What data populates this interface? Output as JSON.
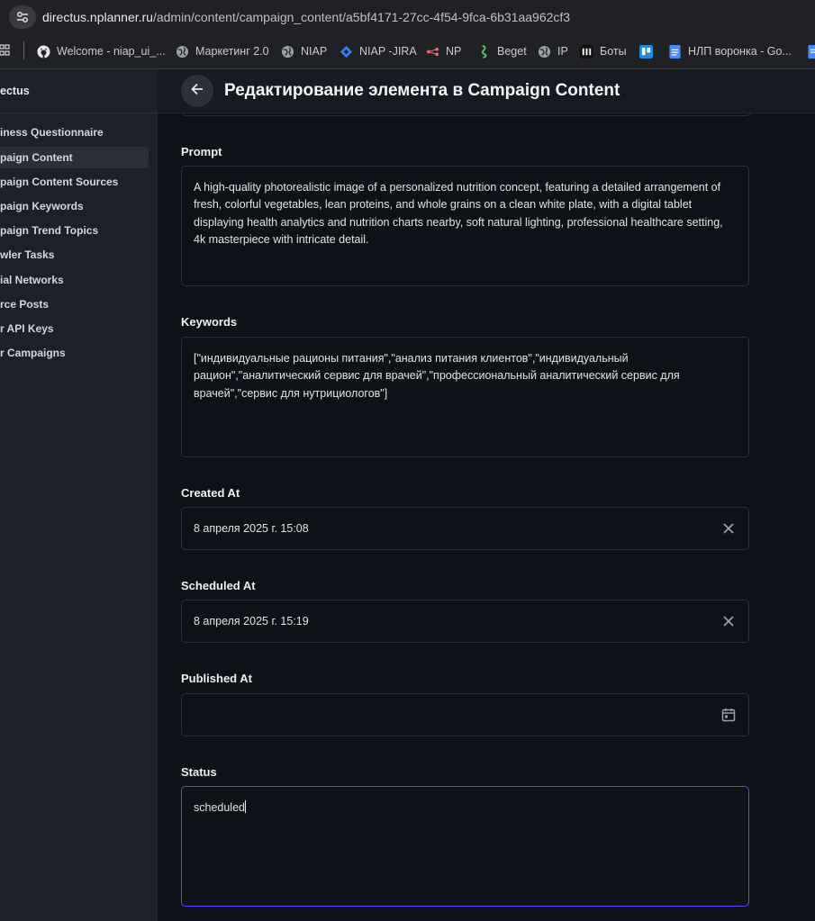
{
  "browser": {
    "url_host": "directus.nplanner.ru",
    "url_path": "/admin/content/campaign_content/a5bf4171-27cc-4f54-9fca-6b31aa962cf3",
    "bookmarks": [
      {
        "label": "Welcome - niap_ui_...",
        "icon": "github-icon"
      },
      {
        "label": "Маркетинг 2.0",
        "icon": "globe-icon"
      },
      {
        "label": "NIAP",
        "icon": "globe-icon"
      },
      {
        "label": "NIAP -JIRA",
        "icon": "jira-icon"
      },
      {
        "label": "NP",
        "icon": "link-icon"
      },
      {
        "label": "Beget",
        "icon": "beget-icon"
      },
      {
        "label": "IP",
        "icon": "globe-icon"
      },
      {
        "label": "Боты",
        "icon": "bots-icon"
      },
      {
        "label": "",
        "icon": "trello-icon"
      },
      {
        "label": "НЛП воронка - Go...",
        "icon": "docs-icon"
      }
    ]
  },
  "sidebar": {
    "title": "ectus",
    "items": [
      {
        "label": "iness Questionnaire"
      },
      {
        "label": "paign Content",
        "active": true
      },
      {
        "label": "paign Content Sources"
      },
      {
        "label": "paign Keywords"
      },
      {
        "label": "paign Trend Topics"
      },
      {
        "label": "wler Tasks"
      },
      {
        "label": "ial Networks"
      },
      {
        "label": "rce Posts"
      },
      {
        "label": "r API Keys"
      },
      {
        "label": "r Campaigns"
      }
    ]
  },
  "header": {
    "title": "Редактирование элемента в Campaign Content"
  },
  "form": {
    "prompt": {
      "label": "Prompt",
      "value": "A high-quality photorealistic image of a personalized nutrition concept, featuring a detailed arrangement of fresh, colorful vegetables, lean proteins, and whole grains on a clean white plate, with a digital tablet displaying health analytics and nutrition charts nearby, soft natural lighting, professional healthcare setting, 4k masterpiece with intricate detail."
    },
    "keywords": {
      "label": "Keywords",
      "value": "[\"индивидуальные рационы питания\",\"анализ питания клиентов\",\"индивидуальный рацион\",\"аналитический сервис для врачей\",\"профессиональный аналитический сервис для врачей\",\"сервис для нутрициологов\"]"
    },
    "created_at": {
      "label": "Created At",
      "value": "8 апреля 2025 г. 15:08"
    },
    "scheduled_at": {
      "label": "Scheduled At",
      "value": "8 апреля 2025 г. 15:19"
    },
    "published_at": {
      "label": "Published At",
      "value": ""
    },
    "status": {
      "label": "Status",
      "value": "scheduled"
    }
  },
  "colors": {
    "accent": "#6644ff",
    "background": "#0e1117",
    "sidebar": "#1c2029"
  }
}
